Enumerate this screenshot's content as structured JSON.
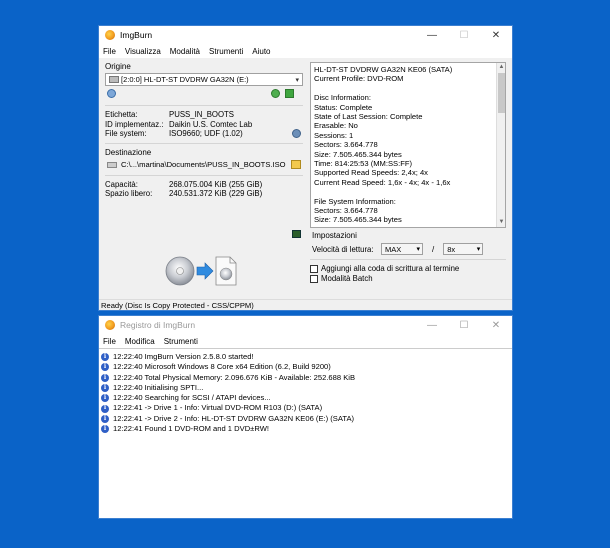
{
  "main_window": {
    "title": "ImgBurn",
    "menu": [
      "File",
      "Visualizza",
      "Modalità",
      "Strumenti",
      "Aiuto"
    ],
    "origine": {
      "label": "Origine",
      "drive_value": "[2:0:0] HL-DT-ST DVDRW  GA32N (E:)"
    },
    "disc_props": [
      {
        "k": "Etichetta:",
        "v": "PUSS_IN_BOOTS"
      },
      {
        "k": "ID implementaz.:",
        "v": "Daikin U.S. Comtec Lab"
      },
      {
        "k": "File system:",
        "v": "ISO9660; UDF (1.02)"
      }
    ],
    "destinazione": {
      "label": "Destinazione",
      "path": "C:\\...\\martina\\Documents\\PUSS_IN_BOOTS.ISO"
    },
    "capacity": [
      {
        "k": "Capacità:",
        "v": "268.075.004 KiB  (255 GiB)"
      },
      {
        "k": "Spazio libero:",
        "v": "240.531.372 KiB  (229 GiB)"
      }
    ],
    "info_lines": [
      "HL-DT-ST DVDRW  GA32N KE06 (SATA)",
      "Current Profile: DVD-ROM",
      "",
      "Disc Information:",
      "Status: Complete",
      "State of Last Session: Complete",
      "Erasable: No",
      "Sessions: 1",
      "Sectors: 3.664.778",
      "Size: 7.505.465.344 bytes",
      "Time: 814:25:53 (MM:SS:FF)",
      "Supported Read Speeds: 2,4x; 4x",
      "Current Read Speed: 1,6x - 4x; 4x - 1,6x",
      "",
      "File System Information:",
      "Sectors: 3.664.778",
      "Size: 7.505.465.344 bytes"
    ],
    "impostazioni": {
      "label": "Impostazioni",
      "speed_label": "Velocità di lettura:",
      "speed_value": "MAX",
      "slash": "/",
      "speed_value2": "8x",
      "queue_label": "Aggiungi alla coda di scrittura al termine",
      "batch_label": "Modalità Batch"
    },
    "status": "Ready (Disc Is Copy Protected - CSS/CPPM)"
  },
  "log_window": {
    "title": "Registro di ImgBurn",
    "menu": [
      "File",
      "Modifica",
      "Strumenti"
    ],
    "lines": [
      "12:22:40 ImgBurn Version 2.5.8.0 started!",
      "12:22:40 Microsoft Windows 8 Core x64 Edition (6.2, Build 9200)",
      "12:22:40 Total Physical Memory: 2.096.676 KiB  -  Available: 252.688 KiB",
      "12:22:40 Initialising SPTI...",
      "12:22:40 Searching for SCSI / ATAPI devices...",
      "12:22:41 -> Drive 1 - Info: Virtual DVD-ROM R103 (D:) (SATA)",
      "12:22:41 -> Drive 2 - Info: HL-DT-ST DVDRW  GA32N KE06 (E:) (SATA)",
      "12:22:41 Found 1 DVD-ROM and 1 DVD±RW!"
    ]
  },
  "window_controls": {
    "minimize": "—",
    "maximize": "☐",
    "close": "✕"
  }
}
